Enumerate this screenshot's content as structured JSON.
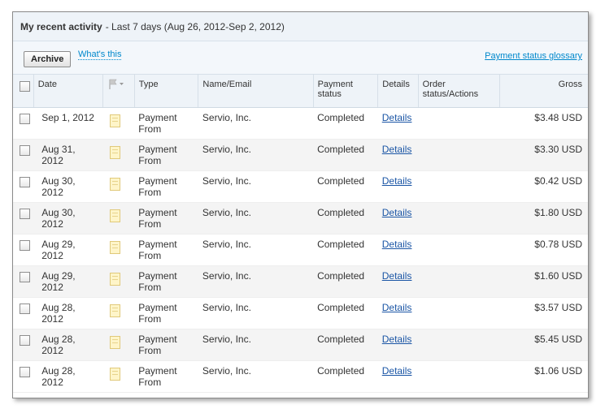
{
  "header": {
    "title": "My recent activity",
    "subtitle": "- Last 7 days (Aug 26, 2012-Sep 2, 2012)"
  },
  "toolbar": {
    "archive_label": "Archive",
    "whats_this": "What's this",
    "glossary": "Payment status glossary"
  },
  "columns": {
    "date": "Date",
    "type": "Type",
    "name": "Name/Email",
    "status": "Payment status",
    "details": "Details",
    "order": "Order status/Actions",
    "gross": "Gross"
  },
  "rows": [
    {
      "date": "Sep 1, 2012",
      "type": "Payment From",
      "name": "Servio, Inc.",
      "status": "Completed",
      "details": "Details",
      "gross": "$3.48 USD"
    },
    {
      "date": "Aug 31, 2012",
      "type": "Payment From",
      "name": "Servio, Inc.",
      "status": "Completed",
      "details": "Details",
      "gross": "$3.30 USD"
    },
    {
      "date": "Aug 30, 2012",
      "type": "Payment From",
      "name": "Servio, Inc.",
      "status": "Completed",
      "details": "Details",
      "gross": "$0.42 USD"
    },
    {
      "date": "Aug 30, 2012",
      "type": "Payment From",
      "name": "Servio, Inc.",
      "status": "Completed",
      "details": "Details",
      "gross": "$1.80 USD"
    },
    {
      "date": "Aug 29, 2012",
      "type": "Payment From",
      "name": "Servio, Inc.",
      "status": "Completed",
      "details": "Details",
      "gross": "$0.78 USD"
    },
    {
      "date": "Aug 29, 2012",
      "type": "Payment From",
      "name": "Servio, Inc.",
      "status": "Completed",
      "details": "Details",
      "gross": "$1.60 USD"
    },
    {
      "date": "Aug 28, 2012",
      "type": "Payment From",
      "name": "Servio, Inc.",
      "status": "Completed",
      "details": "Details",
      "gross": "$3.57 USD"
    },
    {
      "date": "Aug 28, 2012",
      "type": "Payment From",
      "name": "Servio, Inc.",
      "status": "Completed",
      "details": "Details",
      "gross": "$5.45 USD"
    },
    {
      "date": "Aug 28, 2012",
      "type": "Payment From",
      "name": "Servio, Inc.",
      "status": "Completed",
      "details": "Details",
      "gross": "$1.06 USD"
    }
  ],
  "icons": {
    "note": "note-icon",
    "flag": "flag-icon"
  },
  "colors": {
    "link": "#1a55a5",
    "header_bg": "#eef3f8"
  }
}
